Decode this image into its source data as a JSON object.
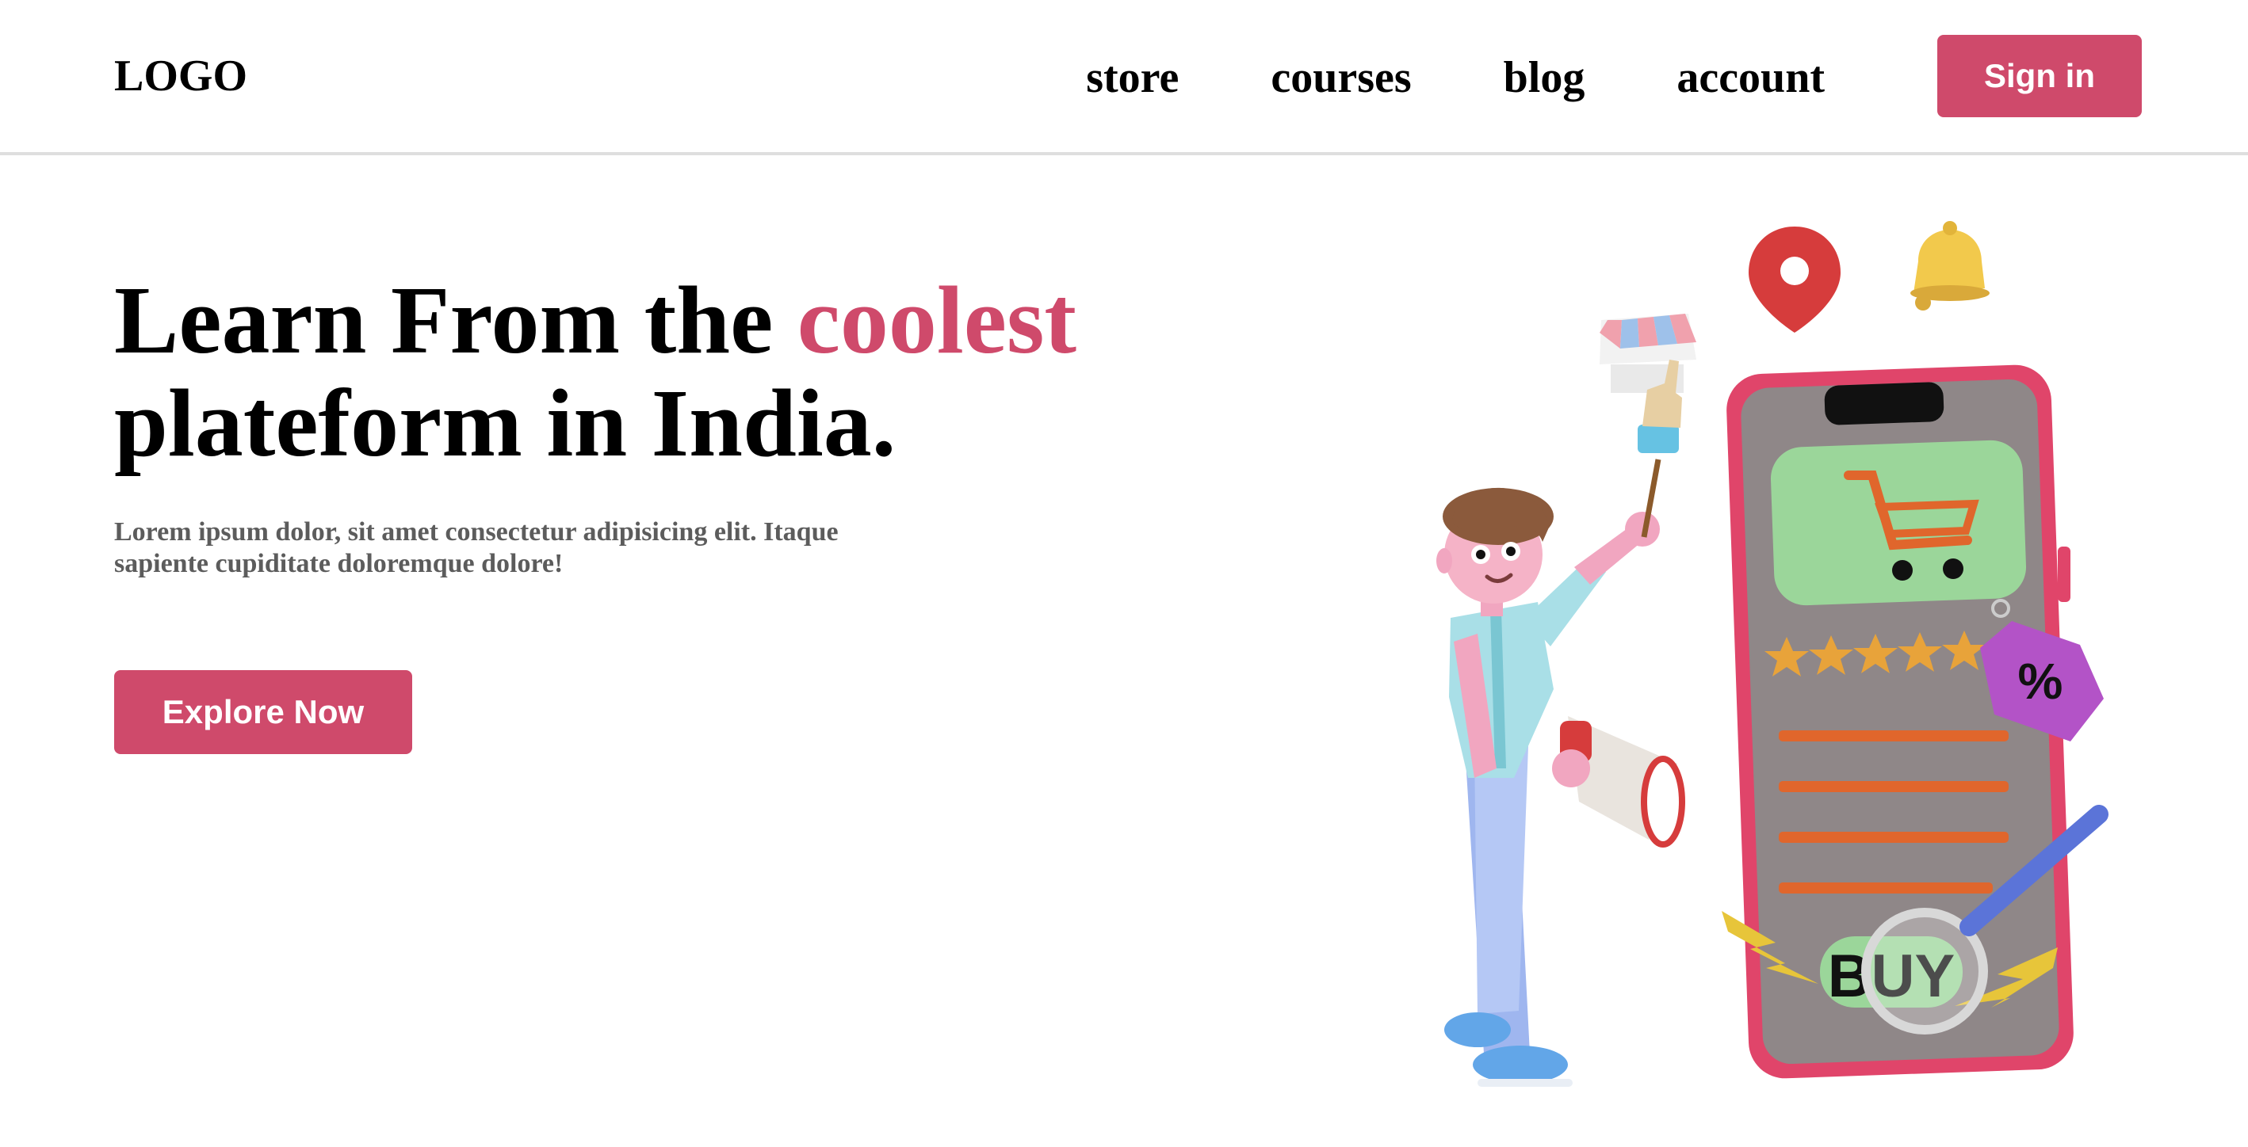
{
  "header": {
    "logo": "LOGO",
    "nav": [
      "store",
      "courses",
      "blog",
      "account"
    ],
    "signin_label": "Sign in"
  },
  "hero": {
    "title_part1": "Learn From the",
    "title_accent": "coolest",
    "title_line2": "plateform in India.",
    "description_line1": "Lorem ipsum dolor, sit amet consectetur adipisicing elit. Itaque",
    "description_line2": "sapiente cupiditate doloremque dolore!",
    "cta_label": "Explore Now"
  },
  "illustration": {
    "buy_text": "BUY",
    "discount_text": "%",
    "rating_stars": 5
  },
  "colors": {
    "accent": "#cf4a6b",
    "text": "#000000",
    "muted_text": "#5c5c5c",
    "divider": "#dedede",
    "phone_frame": "#e0456a",
    "phone_screen": "#8f8788",
    "card_green": "#9bd69a",
    "orange": "#e0662c",
    "star": "#e8a33a"
  },
  "icons": [
    "location-pin-icon",
    "bell-icon",
    "store-icon",
    "hand-pointer-icon",
    "cart-icon",
    "discount-tag-icon",
    "magnifier-icon",
    "lightning-icon",
    "megaphone-icon"
  ]
}
